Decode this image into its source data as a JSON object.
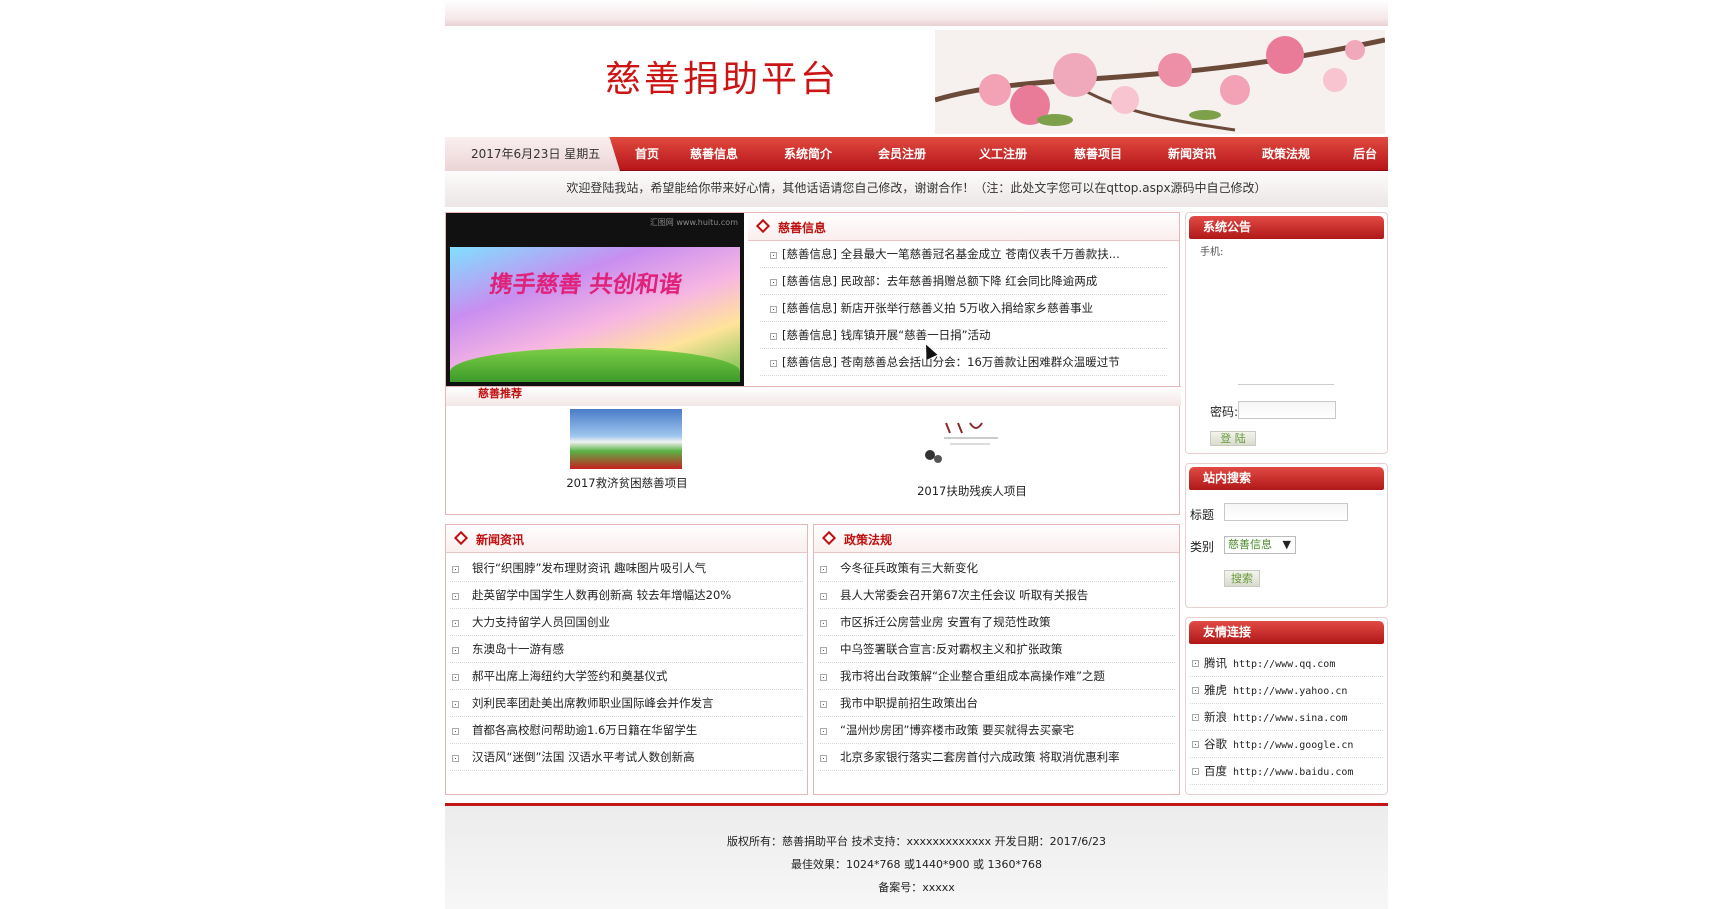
{
  "header": {
    "site_title": "慈善捐助平台"
  },
  "nav": {
    "date": "2017年6月23日 星期五",
    "items": [
      "首页",
      "慈善信息",
      "系统简介",
      "会员注册",
      "义工注册",
      "慈善项目",
      "新闻资讯",
      "政策法规",
      "后台"
    ]
  },
  "welcome": "欢迎登陆我站，希望能给你带来好心情，其他话语请您自己修改，谢谢合作！（注：此处文字您可以在qttop.aspx源码中自己修改）",
  "photo": {
    "caption": "携手慈善 共创和谐",
    "watermark": "汇图网 www.huitu.com"
  },
  "charity_info": {
    "title": "慈善信息",
    "items": [
      "[慈善信息] 全县最大一笔慈善冠名基金成立 苍南仪表千万善款扶...",
      "[慈善信息] 民政部：去年慈善捐赠总额下降 红会同比降逾两成",
      "[慈善信息] 新店开张举行慈善义拍 5万收入捐给家乡慈善事业",
      "[慈善信息] 钱库镇开展“慈善一日捐”活动",
      "[慈善信息] 苍南慈善总会括山分会：16万善款让困难群众温暖过节"
    ]
  },
  "recommend": {
    "title": "慈善推荐",
    "items": [
      {
        "caption": "2017救济贫困慈善项目"
      },
      {
        "caption": "2017扶助残疾人项目"
      }
    ]
  },
  "news": {
    "title": "新闻资讯",
    "items": [
      "银行“织围脖”发布理财资讯 趣味图片吸引人气",
      "赴英留学中国学生人数再创新高 较去年增幅达20%",
      "大力支持留学人员回国创业",
      "东澳岛十一游有感",
      "郝平出席上海纽约大学签约和奠基仪式",
      "刘利民率团赴美出席教师职业国际峰会并作发言",
      "首都各高校慰问帮助逾1.6万日籍在华留学生",
      "汉语风“迷倒”法国 汉语水平考试人数创新高"
    ]
  },
  "policy": {
    "title": "政策法规",
    "items": [
      "今冬征兵政策有三大新变化",
      "县人大常委会召开第67次主任会议 听取有关报告",
      "市区拆迁公房营业房 安置有了规范性政策",
      "中乌签署联合宣言:反对霸权主义和扩张政策",
      "我市将出台政策解“企业整合重组成本高操作难”之题",
      "我市中职提前招生政策出台",
      "“温州炒房团”博弈楼市政策 要买就得去买豪宅",
      "北京多家银行落实二套房首付六成政策 将取消优惠利率"
    ]
  },
  "notice": {
    "title": "系统公告",
    "username_label": "手机:",
    "password_label": "密码:",
    "login_button": "登 陆"
  },
  "search": {
    "title": "站内搜索",
    "title_label": "标题",
    "category_label": "类别",
    "category_value": "慈善信息",
    "search_button": "搜索"
  },
  "links": {
    "title": "友情连接",
    "items": [
      {
        "name": "腾讯",
        "url": "http://www.qq.com"
      },
      {
        "name": "雅虎",
        "url": "http://www.yahoo.cn"
      },
      {
        "name": "新浪",
        "url": "http://www.sina.com"
      },
      {
        "name": "谷歌",
        "url": "http://www.google.cn"
      },
      {
        "name": "百度",
        "url": "http://www.baidu.com"
      }
    ]
  },
  "footer": {
    "line1": "版权所有：慈善捐助平台 技术支持：xxxxxxxxxxxxx 开发日期：2017/6/23",
    "line2": "最佳效果：1024*768 或1440*900 或 1360*768",
    "line3": "备案号：xxxxx"
  },
  "colors": {
    "brand_red": "#c01010",
    "nav_red": "#b8151a"
  }
}
